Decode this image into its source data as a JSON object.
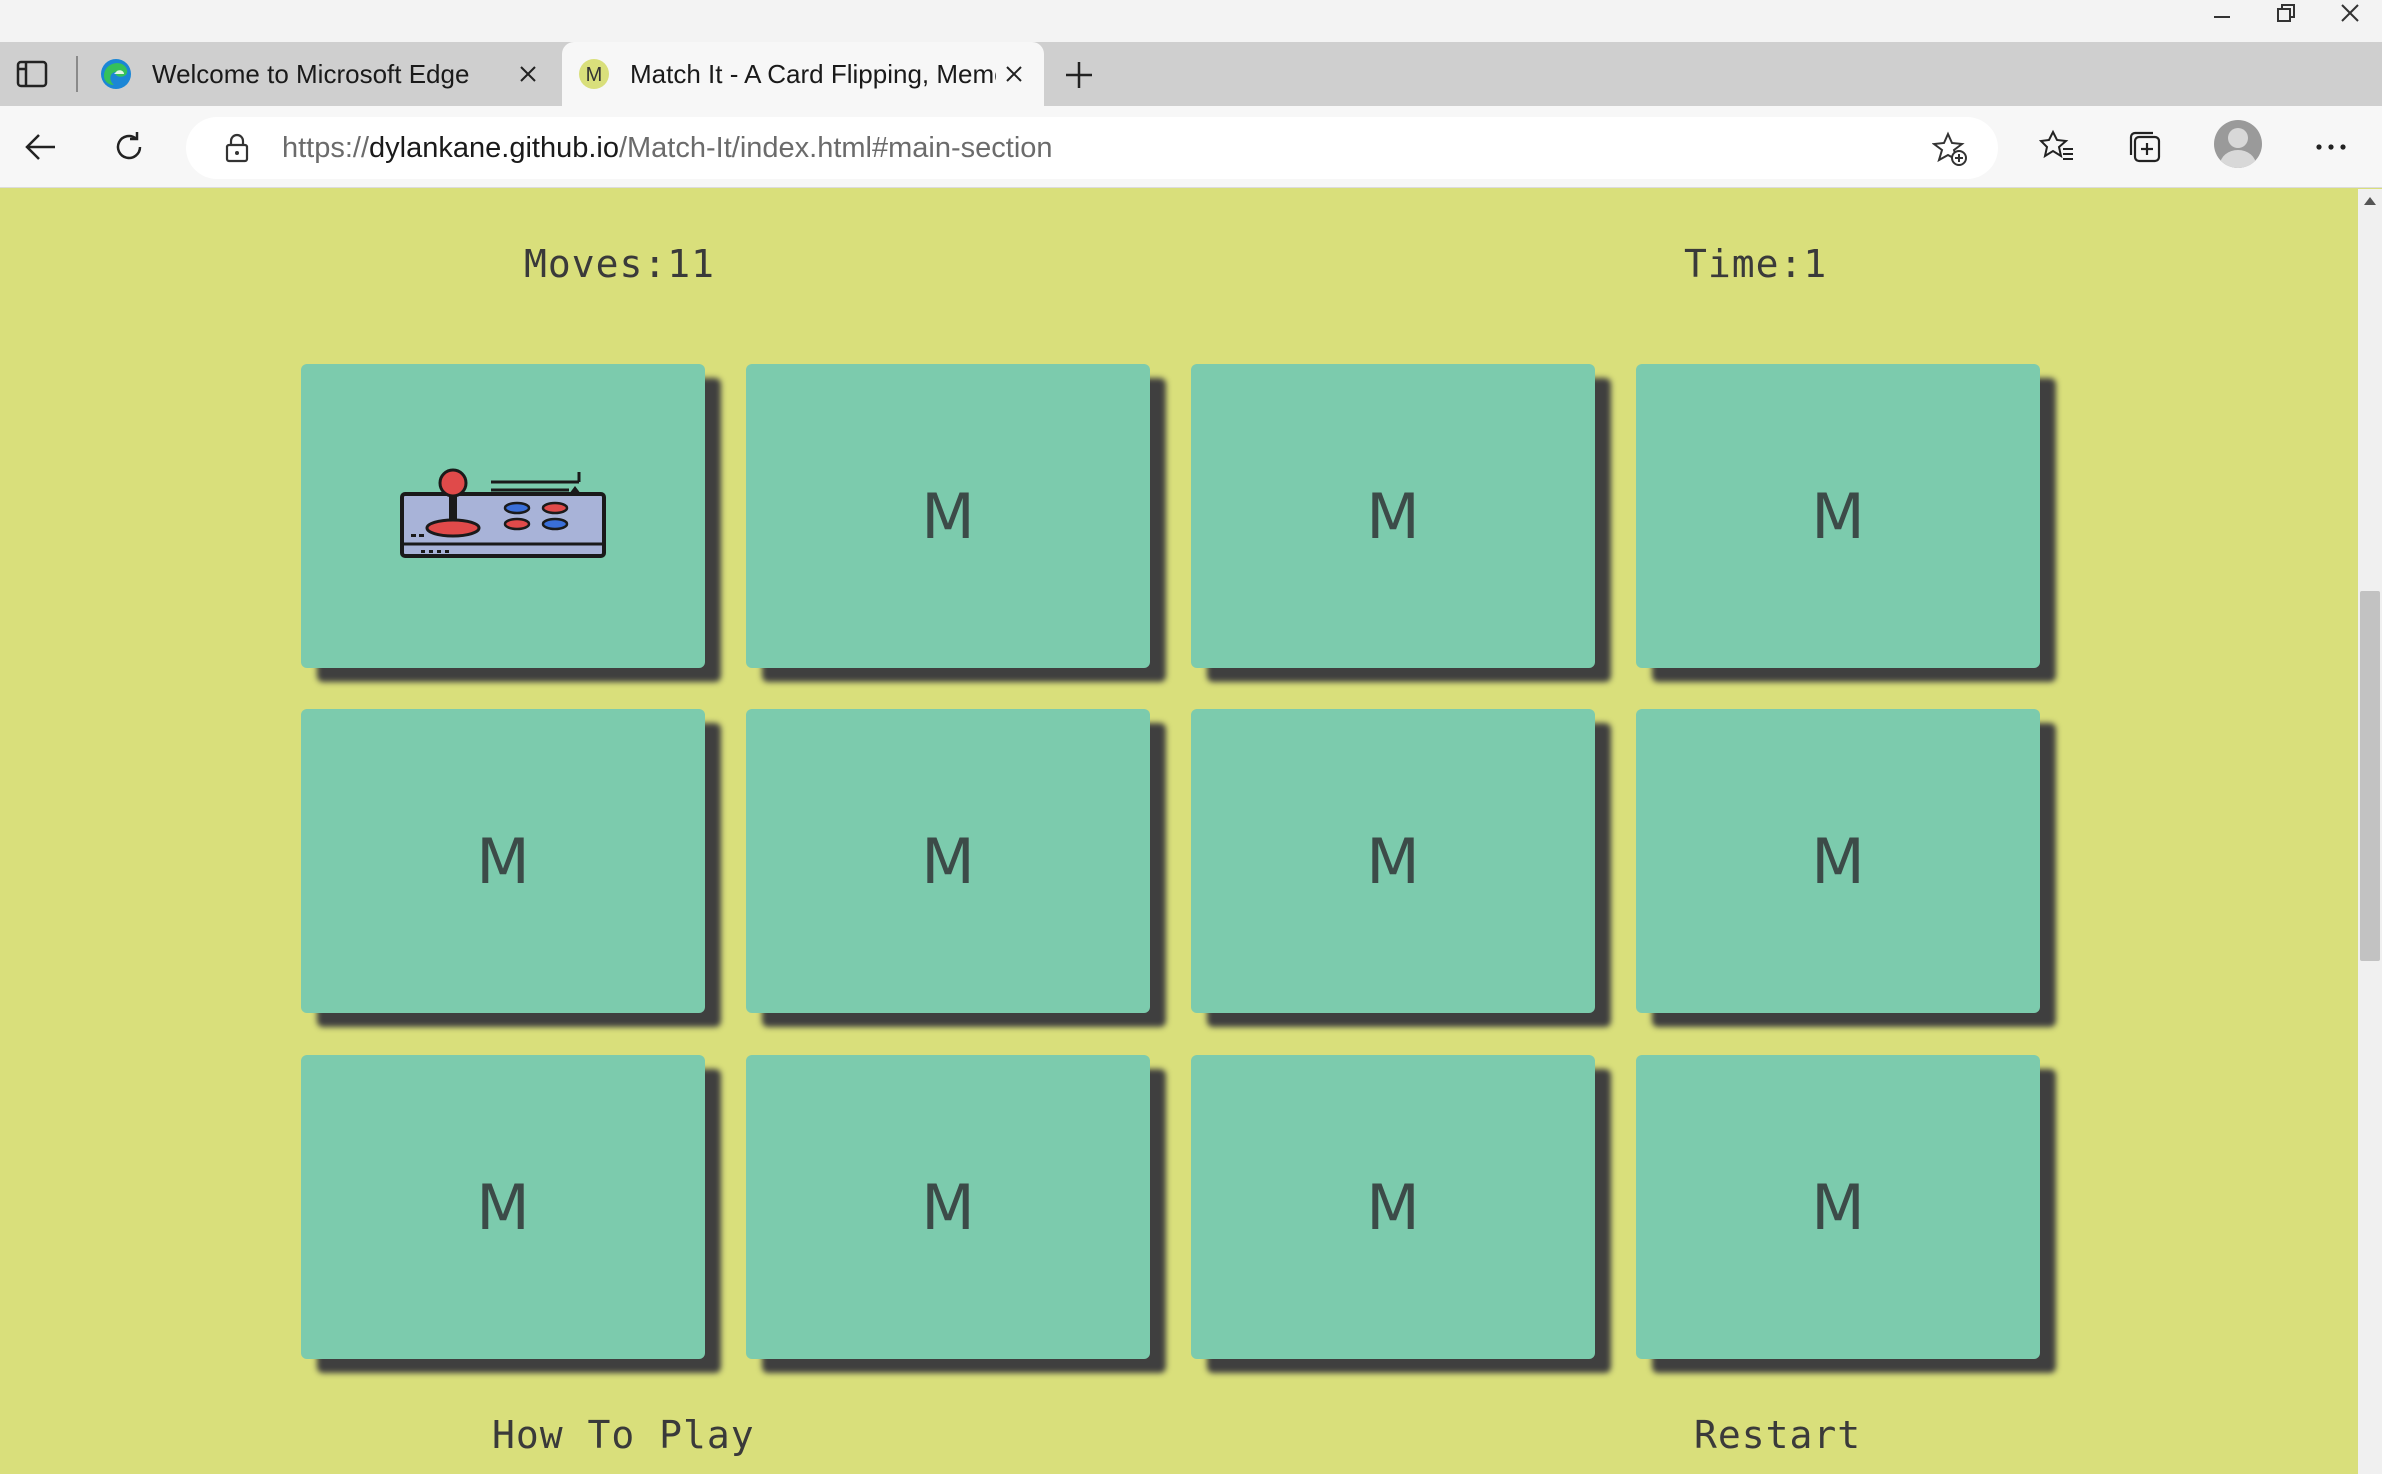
{
  "browser": {
    "tabs": [
      {
        "title": "Welcome to Microsoft Edge",
        "favicon": "edge-logo-icon",
        "active": false
      },
      {
        "title": "Match It - A Card Flipping, Memory Game",
        "favicon": "m-favicon-icon",
        "favicon_letter": "M",
        "active": true
      }
    ],
    "url": {
      "scheme": "https://",
      "host": "dylankane.github.io",
      "path": "/Match-It/index.html#main-section"
    }
  },
  "game": {
    "moves_text": "Moves:11",
    "time_text": "Time:1",
    "cards": [
      {
        "face": "joystick-controller-icon",
        "label": ""
      },
      {
        "face": "back",
        "label": "M"
      },
      {
        "face": "back",
        "label": "M"
      },
      {
        "face": "back",
        "label": "M"
      },
      {
        "face": "back",
        "label": "M"
      },
      {
        "face": "back",
        "label": "M"
      },
      {
        "face": "back",
        "label": "M"
      },
      {
        "face": "back",
        "label": "M"
      },
      {
        "face": "back",
        "label": "M"
      },
      {
        "face": "back",
        "label": "M"
      },
      {
        "face": "back",
        "label": "M"
      },
      {
        "face": "back",
        "label": "M"
      }
    ],
    "how_to_play_label": "How To Play",
    "restart_label": "Restart"
  },
  "colors": {
    "page_background": "#d9df7b",
    "card": "#7ccbad",
    "card_shadow": "#3f3f3f",
    "text": "#3a3a3a"
  }
}
